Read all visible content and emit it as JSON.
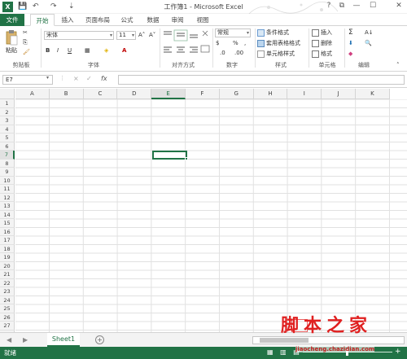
{
  "window": {
    "title": "工作簿1 - Microsoft Excel",
    "logo_letter": "X",
    "qat": {
      "save": "💾",
      "undo": "↶",
      "redo": "↷",
      "customize": "⇣"
    },
    "controls": {
      "help": "?",
      "ribbon_opts": "⧉",
      "minimize": "—",
      "maximize": "☐",
      "close": "✕"
    }
  },
  "tabs": [
    "文件",
    "开始",
    "插入",
    "页面布局",
    "公式",
    "数据",
    "审阅",
    "视图"
  ],
  "ribbon": {
    "clipboard": {
      "paste": "粘贴",
      "label": "剪贴板"
    },
    "font": {
      "name": "宋体",
      "size": "11",
      "grow": "A˄",
      "shrink": "A˅",
      "bold": "B",
      "italic": "I",
      "underline": "U",
      "label": "字体"
    },
    "alignment": {
      "label": "对齐方式"
    },
    "number": {
      "format": "常规",
      "percent": "%",
      "comma": ",",
      "label": "数字"
    },
    "styles": {
      "conditional": "条件格式",
      "table": "套用表格格式",
      "cell": "单元格样式",
      "label": "样式"
    },
    "cells": {
      "insert": "插入",
      "delete": "删除",
      "format": "格式",
      "label": "单元格"
    },
    "editing": {
      "sum": "Σ",
      "sort": "A↓",
      "find": "🔍",
      "label": "编辑"
    }
  },
  "formula_bar": {
    "name_box": "E7",
    "cancel": "×",
    "enter": "✓",
    "fx": "fx",
    "value": ""
  },
  "sheet": {
    "columns": [
      "A",
      "B",
      "C",
      "D",
      "E",
      "F",
      "G",
      "H",
      "I",
      "J",
      "K"
    ],
    "rows": [
      "1",
      "2",
      "3",
      "4",
      "5",
      "6",
      "7",
      "8",
      "9",
      "10",
      "11",
      "12",
      "13",
      "14",
      "15",
      "16",
      "17",
      "18",
      "19",
      "20",
      "21",
      "22",
      "23",
      "24",
      "25",
      "26",
      "27",
      "28"
    ],
    "selected_column": "E",
    "selected_row": "7"
  },
  "sheet_tabs": {
    "active": "Sheet1",
    "add": "+",
    "nav_prev": "◀",
    "nav_next": "▶"
  },
  "status": {
    "ready": "就绪",
    "views": "▦ ▥ ▤",
    "zoom_out": "−",
    "zoom_in": "+"
  },
  "watermark": {
    "text": "脚本之家",
    "sub": "jiaocheng.chazidian.com"
  },
  "colors": {
    "accent": "#217346"
  }
}
